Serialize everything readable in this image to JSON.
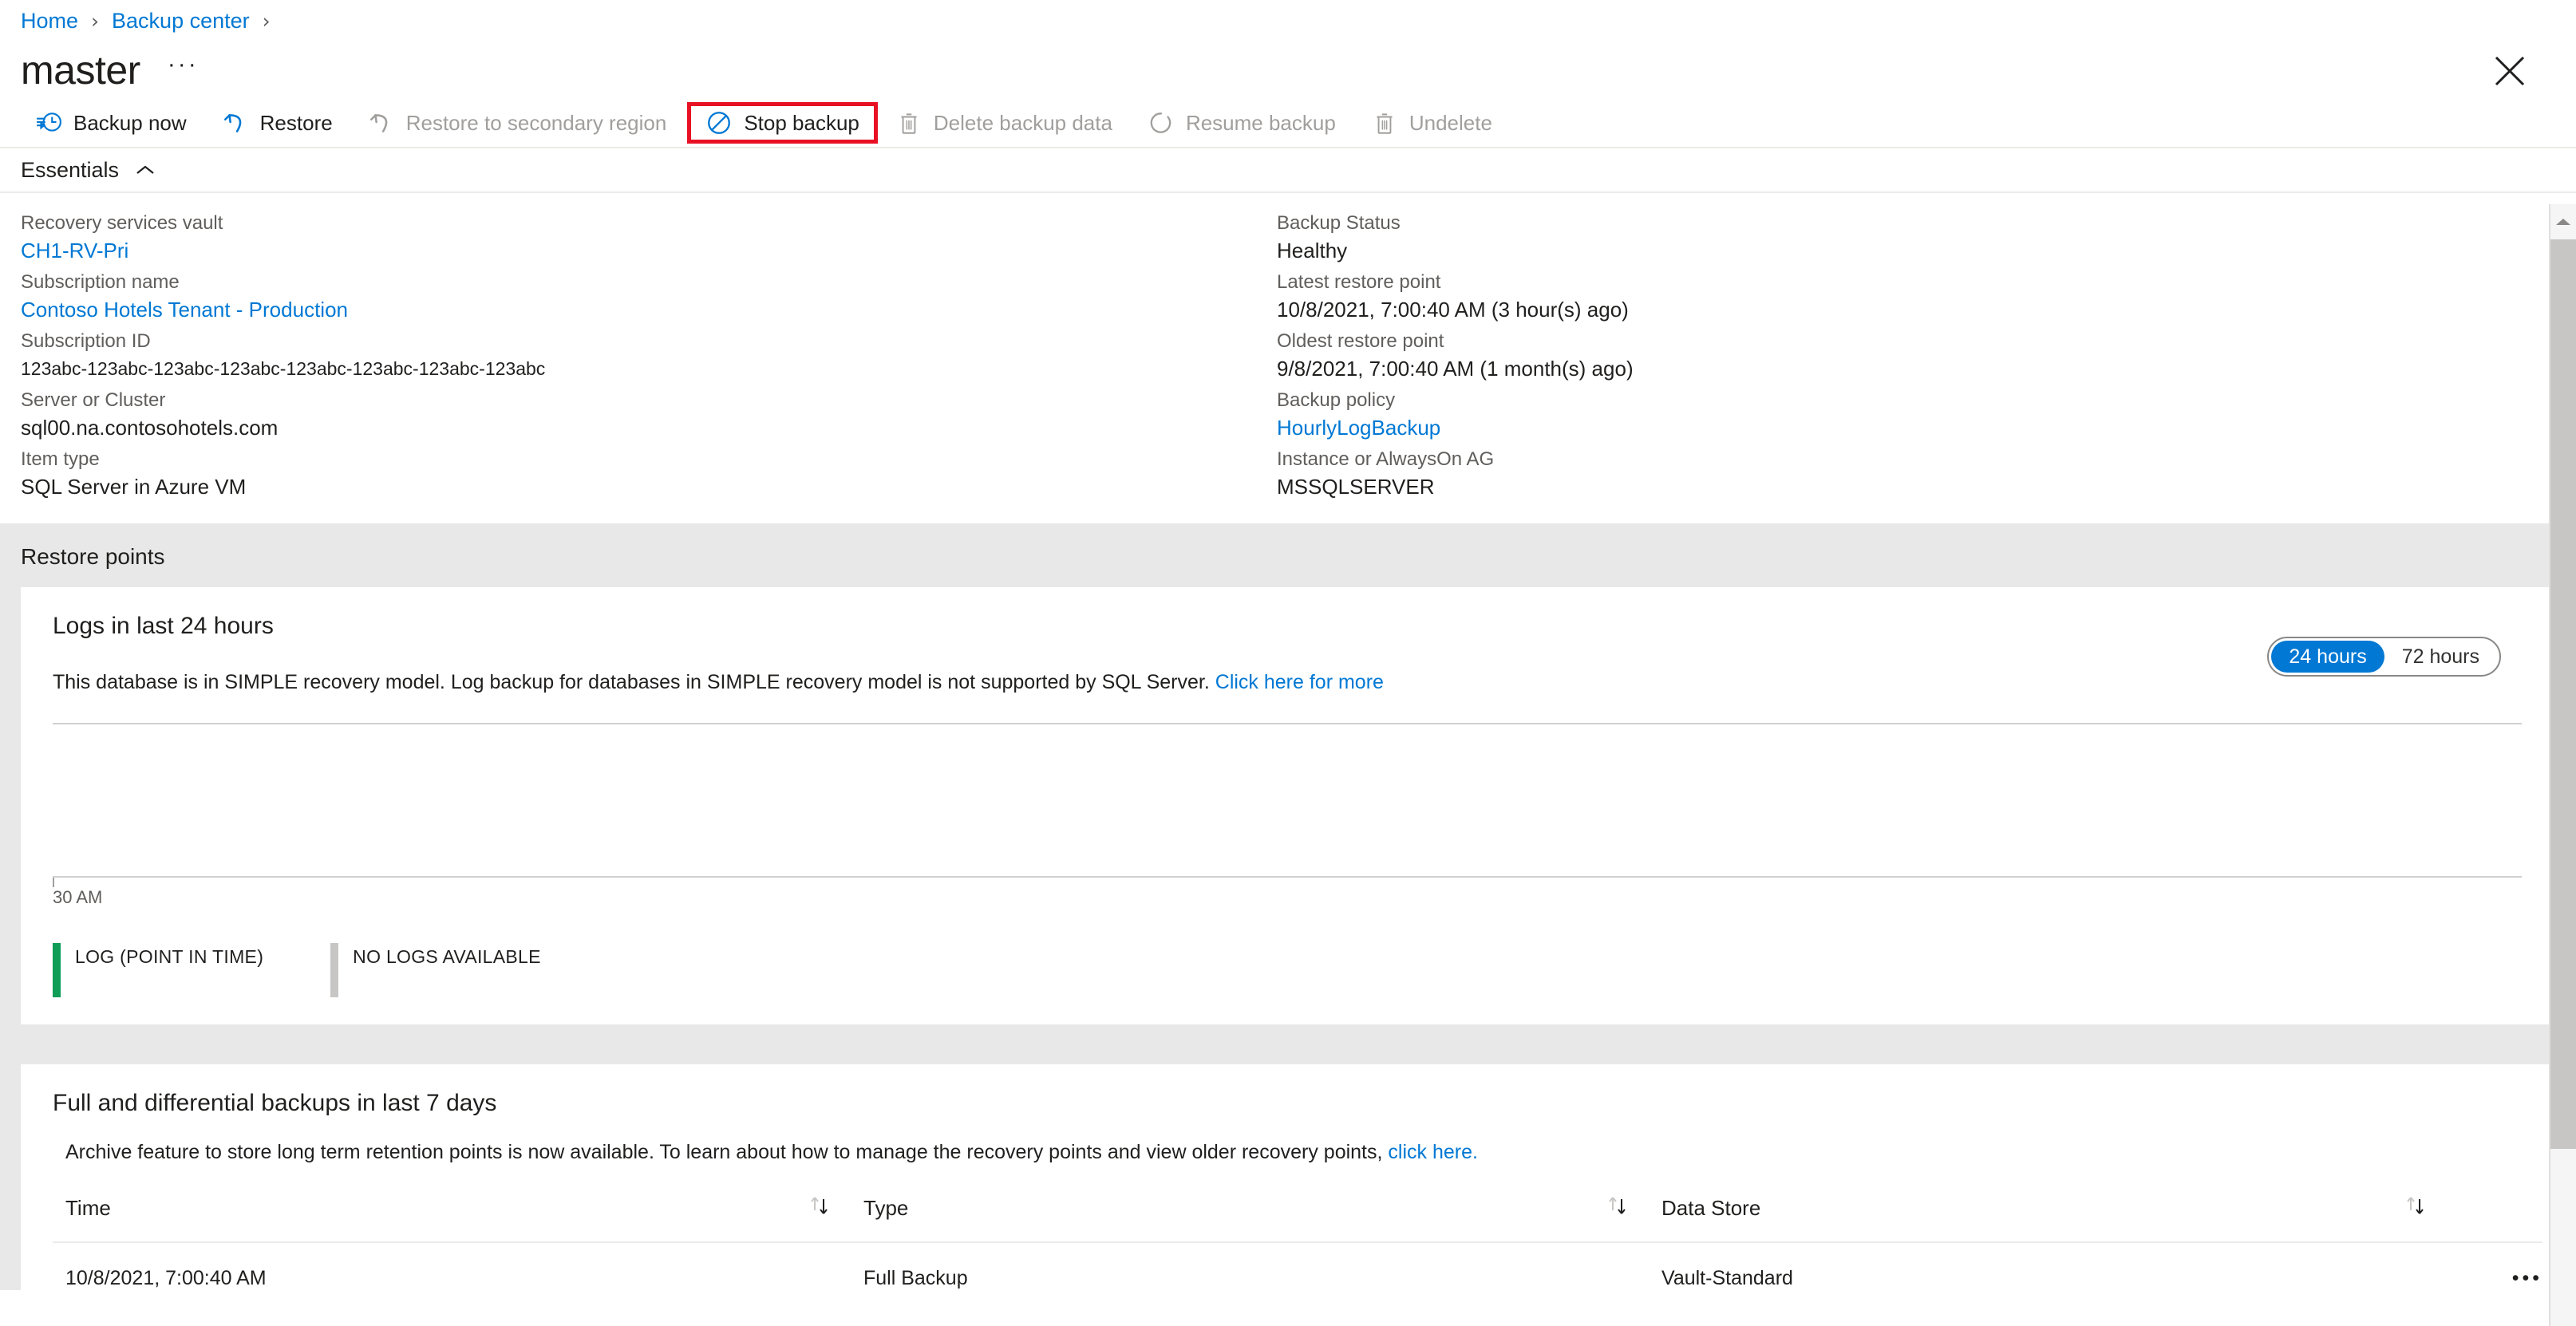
{
  "breadcrumb": {
    "items": [
      {
        "label": "Home",
        "type": "link"
      },
      {
        "label": "Backup center",
        "type": "link"
      }
    ],
    "separator": "›"
  },
  "header": {
    "title": "master",
    "more_label": "···",
    "close_label": "×"
  },
  "commandbar": {
    "items": [
      {
        "label": "Backup now",
        "icon": "backup-now-icon",
        "enabled": true,
        "highlighted": false
      },
      {
        "label": "Restore",
        "icon": "restore-icon",
        "enabled": true,
        "highlighted": false
      },
      {
        "label": "Restore to secondary region",
        "icon": "restore-secondary-icon",
        "enabled": false,
        "highlighted": false
      },
      {
        "label": "Stop backup",
        "icon": "stop-backup-icon",
        "enabled": true,
        "highlighted": true
      },
      {
        "label": "Delete backup data",
        "icon": "trash-icon",
        "enabled": false,
        "highlighted": false
      },
      {
        "label": "Resume backup",
        "icon": "resume-backup-icon",
        "enabled": false,
        "highlighted": false
      },
      {
        "label": "Undelete",
        "icon": "trash-icon",
        "enabled": false,
        "highlighted": false
      }
    ],
    "highlight_color": "#e81123"
  },
  "essentials": {
    "title": "Essentials",
    "expanded": true,
    "left_fields": [
      {
        "label": "Recovery services vault",
        "value": "CH1-RV-Pri",
        "is_link": true
      },
      {
        "label": "Subscription name",
        "value": "Contoso Hotels Tenant - Production",
        "is_link": true
      },
      {
        "label": "Subscription ID",
        "value": "123abc-123abc-123abc-123abc-123abc-123abc-123abc-123abc",
        "is_link": false
      },
      {
        "label": "Server or Cluster",
        "value": "sql00.na.contosohotels.com",
        "is_link": false
      },
      {
        "label": "Item type",
        "value": "SQL Server in Azure VM",
        "is_link": false
      }
    ],
    "right_fields": [
      {
        "label": "Backup Status",
        "value": "Healthy",
        "is_link": false
      },
      {
        "label": "Latest restore point",
        "value": "10/8/2021, 7:00:40 AM (3 hour(s) ago)",
        "is_link": false
      },
      {
        "label": "Oldest restore point",
        "value": "9/8/2021, 7:00:40 AM (1 month(s) ago)",
        "is_link": false
      },
      {
        "label": "Backup policy",
        "value": "HourlyLogBackup",
        "is_link": true
      },
      {
        "label": "Instance or AlwaysOn AG",
        "value": "MSSQLSERVER",
        "is_link": false
      }
    ]
  },
  "restore_points": {
    "section_title": "Restore points",
    "logs_card": {
      "title": "Logs in last 24 hours",
      "note_text": "This database is in SIMPLE recovery model. Log backup for databases in SIMPLE recovery model is not supported by SQL Server.",
      "note_link": "Click here for more",
      "range_toggle": {
        "options": [
          "24 hours",
          "72 hours"
        ],
        "selected": "24 hours"
      }
    },
    "backups_card": {
      "title": "Full and differential backups in last 7 days",
      "note_text": "Archive feature to store long term retention points is now available. To learn about how to manage the recovery points and view older recovery points,",
      "note_link": "click here.",
      "columns": [
        "Time",
        "Type",
        "Data Store"
      ],
      "rows": [
        {
          "time": "10/8/2021, 7:00:40 AM",
          "type": "Full Backup",
          "data_store": "Vault-Standard",
          "menu": "•••"
        }
      ]
    }
  },
  "chart_data": {
    "type": "bar",
    "title": "Logs in last 24 hours",
    "xlabel": "",
    "ylabel": "",
    "x_tick_labels": [
      "30 AM"
    ],
    "categories": [],
    "values": [],
    "series": [
      {
        "name": "LOG (POINT IN TIME)",
        "color": "#0f9d58",
        "values": []
      },
      {
        "name": "NO LOGS AVAILABLE",
        "color": "#c8c6c4",
        "values": []
      }
    ],
    "legend": [
      {
        "label": "LOG (POINT IN TIME)",
        "color": "#0f9d58"
      },
      {
        "label": "NO LOGS AVAILABLE",
        "color": "#c8c6c4"
      }
    ],
    "grid": false,
    "legend_position": "bottom",
    "note": "No data plotted — SIMPLE recovery model, log backups not supported"
  },
  "colors": {
    "accent": "#0078d4",
    "highlight": "#e81123",
    "page_bg": "#e8e8e8",
    "legend_log": "#0f9d58",
    "legend_nologs": "#c8c6c4"
  }
}
